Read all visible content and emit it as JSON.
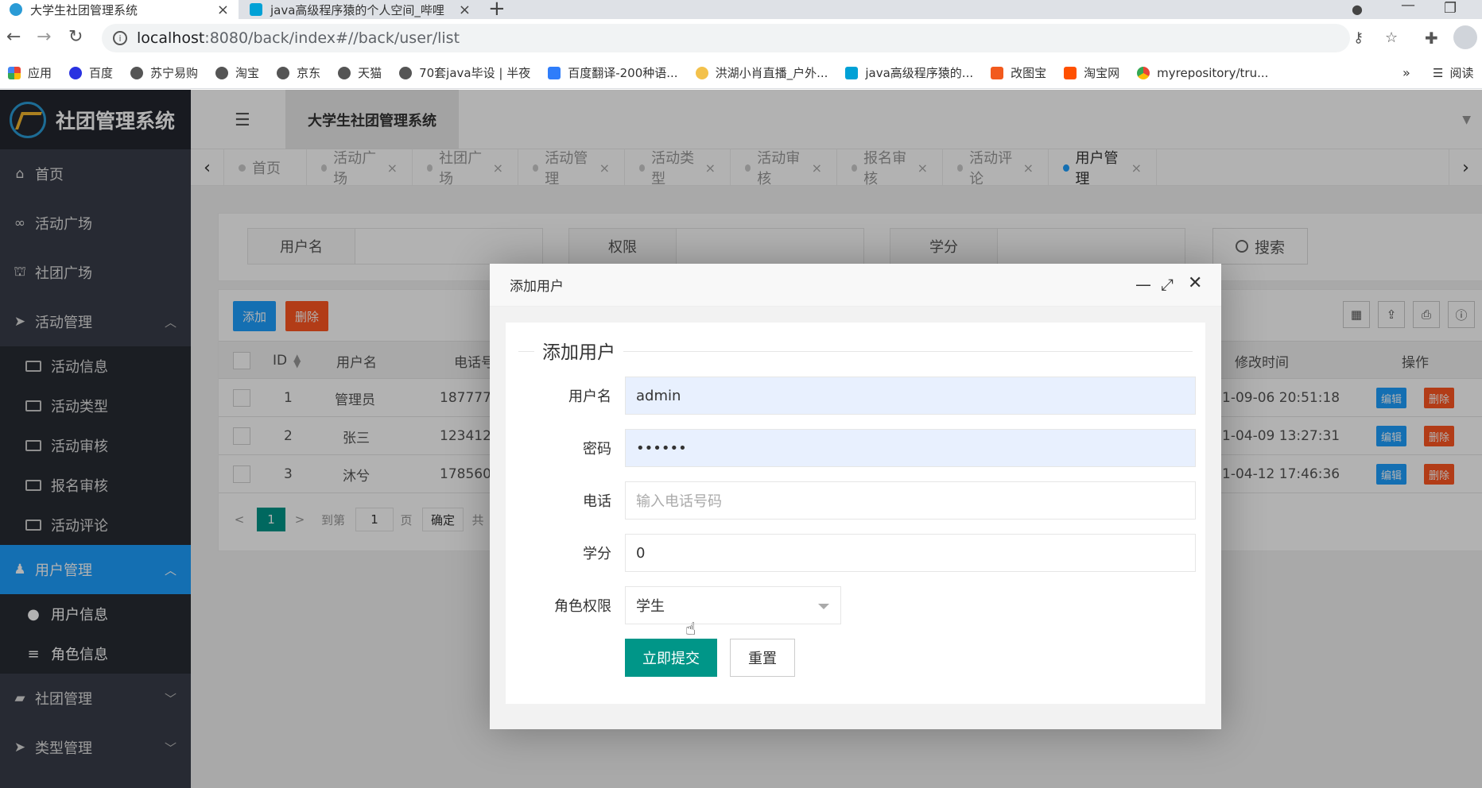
{
  "browser": {
    "tabs": [
      {
        "title": "大学生社团管理系统",
        "close": "×"
      },
      {
        "title": "java高级程序猿的个人空间_哔哩",
        "close": "×"
      }
    ],
    "new_tab": "+",
    "url_host": "localhost",
    "url_rest": ":8080/back/index#//back/user/list",
    "bookmarks": [
      "应用",
      "百度",
      "苏宁易购",
      "淘宝",
      "京东",
      "天猫",
      "70套java毕设 | 半夜",
      "百度翻译-200种语...",
      "洪湖小肖直播_户外...",
      "java高级程序猿的...",
      "改图宝",
      "淘宝网",
      "myrepository/tru..."
    ],
    "bookmarks_more": "»",
    "reading_list": "阅读"
  },
  "app": {
    "logo_text": "社团管理系统",
    "header_title": "大学生社团管理系统",
    "sidebar": {
      "items": [
        {
          "label": "首页",
          "icon": "home-icon"
        },
        {
          "label": "活动广场",
          "icon": "motorcycle-icon"
        },
        {
          "label": "社团广场",
          "icon": "bank-icon"
        },
        {
          "label": "活动管理",
          "icon": "send-icon",
          "caret": "^"
        }
      ],
      "activity_sub": [
        "活动信息",
        "活动类型",
        "活动审核",
        "报名审核",
        "活动评论"
      ],
      "user_mgmt": {
        "label": "用户管理",
        "icon": "users-icon",
        "caret": "^"
      },
      "user_sub": [
        {
          "label": "用户信息",
          "icon": "user-icon"
        },
        {
          "label": "角色信息",
          "icon": "list-icon"
        }
      ],
      "bottom": [
        {
          "label": "社团管理",
          "icon": "book-icon",
          "caret": "v"
        },
        {
          "label": "类型管理",
          "icon": "send-icon",
          "caret": "v"
        }
      ]
    },
    "page_tabs": [
      {
        "label": "首页"
      },
      {
        "label": "活动广场",
        "close": "×"
      },
      {
        "label": "社团广场",
        "close": "×"
      },
      {
        "label": "活动管理",
        "close": "×"
      },
      {
        "label": "活动类型",
        "close": "×"
      },
      {
        "label": "活动审核",
        "close": "×"
      },
      {
        "label": "报名审核",
        "close": "×"
      },
      {
        "label": "活动评论",
        "close": "×"
      },
      {
        "label": "用户管理",
        "close": "×",
        "active": true
      }
    ],
    "search": {
      "fields": [
        "用户名",
        "权限",
        "学分"
      ],
      "button": "搜索"
    },
    "table": {
      "add": "添加",
      "delete": "删除",
      "columns": [
        "ID",
        "用户名",
        "电话号",
        "修改时间",
        "操作"
      ],
      "rows": [
        {
          "id": "1",
          "username": "管理员",
          "phone": "1877777",
          "modified": "1-09-06 20:51:18"
        },
        {
          "id": "2",
          "username": "张三",
          "phone": "1234123",
          "modified": "1-04-09 13:27:31"
        },
        {
          "id": "3",
          "username": "沐兮",
          "phone": "1785607",
          "modified": "1-04-12 17:46:36"
        }
      ],
      "row_edit": "编辑",
      "row_delete": "删除",
      "pager": {
        "prev": "<",
        "page": "1",
        "next": ">",
        "goto": "到第",
        "goto_value": "1",
        "page_unit": "页",
        "confirm": "确定",
        "total_prefix": "共"
      }
    },
    "modal": {
      "title": "添加用户",
      "legend": "添加用户",
      "fields": {
        "username_label": "用户名",
        "username_value": "admin",
        "password_label": "密码",
        "password_value": "••••••",
        "phone_label": "电话",
        "phone_placeholder": "输入电话号码",
        "credit_label": "学分",
        "credit_value": "0",
        "role_label": "角色权限",
        "role_value": "学生"
      },
      "submit": "立即提交",
      "reset": "重置"
    }
  },
  "colors": {
    "sidebar_bg": "#393d49",
    "sidebar_active": "#1e9fff",
    "primary_green": "#009688",
    "btn_blue": "#1e9fff",
    "btn_red": "#ff5722"
  }
}
